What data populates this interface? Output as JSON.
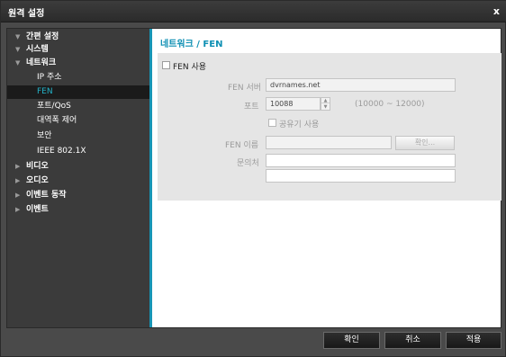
{
  "window": {
    "title": "원격 설정",
    "close": "x"
  },
  "sidebar": {
    "items": [
      {
        "label": "간편 설정",
        "level": 0,
        "expanded": true
      },
      {
        "label": "시스템",
        "level": 0,
        "expanded": true
      },
      {
        "label": "네트워크",
        "level": 0,
        "expanded": true
      },
      {
        "label": "IP 주소",
        "level": 1
      },
      {
        "label": "FEN",
        "level": 1,
        "selected": true
      },
      {
        "label": "포트/QoS",
        "level": 1
      },
      {
        "label": "대역폭 제어",
        "level": 1
      },
      {
        "label": "보안",
        "level": 1
      },
      {
        "label": "IEEE 802.1X",
        "level": 1
      },
      {
        "label": "비디오",
        "level": 0,
        "expanded": false
      },
      {
        "label": "오디오",
        "level": 0,
        "expanded": false
      },
      {
        "label": "이벤트 동작",
        "level": 0,
        "expanded": false
      },
      {
        "label": "이벤트",
        "level": 0,
        "expanded": false
      }
    ],
    "arrow_expanded": "▼",
    "arrow_collapsed": "▶"
  },
  "main": {
    "section_title": "네트워크 / FEN",
    "fen_use_label": "FEN 사용",
    "fen_use_checked": false,
    "fen_server_label": "FEN 서버",
    "fen_server_value": "dvrnames.net",
    "port_label": "포트",
    "port_value": "10088",
    "port_range": "(10000 ~ 12000)",
    "share_label": "공유기 사용",
    "share_checked": false,
    "fen_name_label": "FEN 이름",
    "fen_name_value": "",
    "check_button": "확인...",
    "contact_label": "문의처",
    "contact_value_1": "",
    "contact_value_2": ""
  },
  "footer": {
    "ok": "확인",
    "cancel": "취소",
    "apply": "적용"
  },
  "colors": {
    "accent": "#1795b5",
    "selected_text": "#23b2c8",
    "title_text": "#0d8fb3"
  }
}
